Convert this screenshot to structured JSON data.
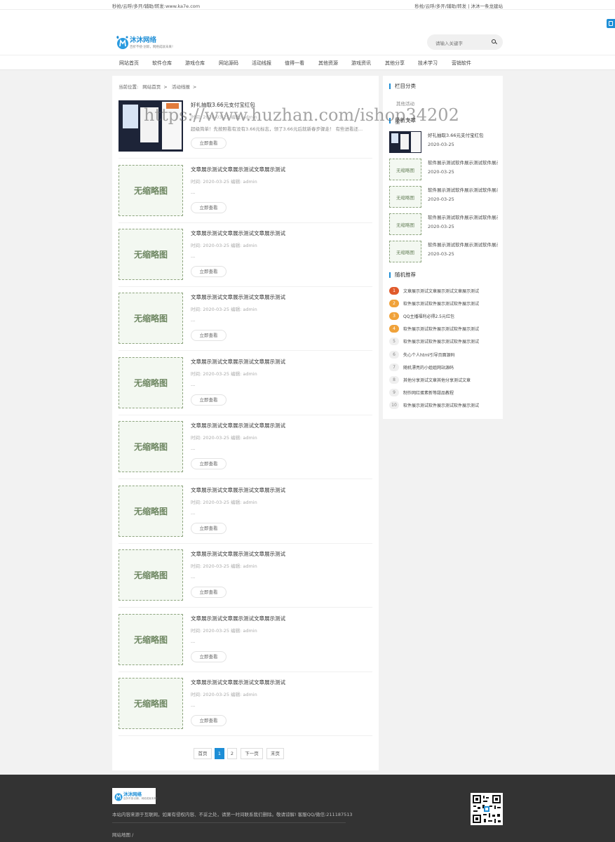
{
  "topbar": {
    "left": "秒抢/云呼/多开/辅助/转发:www.ka7e.com",
    "right": "秒抢/云呼/多开/辅助/转发 | 沐沐一条龙建站"
  },
  "logo": {
    "title": "沐沐网络",
    "slogan": "百折不挠·创新，网络成就未来！"
  },
  "search": {
    "placeholder": "请输入关键字"
  },
  "nav": [
    "网站首页",
    "软件仓库",
    "游戏仓库",
    "网站源码",
    "活动线报",
    "值得一看",
    "其他资源",
    "游戏资讯",
    "其他分享",
    "技术学习",
    "营销软件"
  ],
  "breadcrumb": {
    "label": "当前位置:",
    "home": "网站首页",
    "sep1": ">",
    "current": "活动线报",
    "sep2": ">"
  },
  "watermark": "https://www.huzhan.com/ishop34202",
  "posts": [
    {
      "title": "好礼抽取3.66元支付宝红包",
      "meta": "时间: 2020-03-25    编辑: admin",
      "desc": "超级简单！先按照看有没有3.66元标志，领了3.66元后就新春步骤走！ 有些进看还...",
      "btn": "立即查看",
      "thumb": ""
    },
    {
      "title": "文章展示测试文章展示测试文章展示测试",
      "meta": "时间: 2020-03-25    编辑: admin",
      "desc": "...",
      "btn": "立即查看",
      "thumb": "无缩略图"
    },
    {
      "title": "文章展示测试文章展示测试文章展示测试",
      "meta": "时间: 2020-03-25    编辑: admin",
      "desc": "...",
      "btn": "立即查看",
      "thumb": "无缩略图"
    },
    {
      "title": "文章展示测试文章展示测试文章展示测试",
      "meta": "时间: 2020-03-25    编辑: admin",
      "desc": "...",
      "btn": "立即查看",
      "thumb": "无缩略图"
    },
    {
      "title": "文章展示测试文章展示测试文章展示测试",
      "meta": "时间: 2020-03-25    编辑: admin",
      "desc": "...",
      "btn": "立即查看",
      "thumb": "无缩略图"
    },
    {
      "title": "文章展示测试文章展示测试文章展示测试",
      "meta": "时间: 2020-03-25    编辑: admin",
      "desc": "...",
      "btn": "立即查看",
      "thumb": "无缩略图"
    },
    {
      "title": "文章展示测试文章展示测试文章展示测试",
      "meta": "时间: 2020-03-25    编辑: admin",
      "desc": "...",
      "btn": "立即查看",
      "thumb": "无缩略图"
    },
    {
      "title": "文章展示测试文章展示测试文章展示测试",
      "meta": "时间: 2020-03-25    编辑: admin",
      "desc": "...",
      "btn": "立即查看",
      "thumb": "无缩略图"
    },
    {
      "title": "文章展示测试文章展示测试文章展示测试",
      "meta": "时间: 2020-03-25    编辑: admin",
      "desc": "...",
      "btn": "立即查看",
      "thumb": "无缩略图"
    },
    {
      "title": "文章展示测试文章展示测试文章展示测试",
      "meta": "时间: 2020-03-25    编辑: admin",
      "desc": "...",
      "btn": "立即查看",
      "thumb": "无缩略图"
    }
  ],
  "pagination": {
    "first": "首页",
    "p1": "1",
    "p2": "2",
    "next": "下一页",
    "last": "末页"
  },
  "sidebar": {
    "cat_title": "栏目分类",
    "cat_item": "其他活动",
    "latest_title": "最新文章",
    "latest": [
      {
        "title": "好礼抽取3.66元支付宝红包",
        "date": "2020-03-25",
        "thumb": ""
      },
      {
        "title": "软件展示测试软件展示测试软件展示测试",
        "date": "2020-03-25",
        "thumb": "无缩略图"
      },
      {
        "title": "软件展示测试软件展示测试软件展示测试",
        "date": "2020-03-25",
        "thumb": "无缩略图"
      },
      {
        "title": "软件展示测试软件展示测试软件展示测试",
        "date": "2020-03-25",
        "thumb": "无缩略图"
      },
      {
        "title": "软件展示测试软件展示测试软件展示测试",
        "date": "2020-03-25",
        "thumb": "无缩略图"
      }
    ],
    "rand_title": "随机推荐",
    "random": [
      {
        "n": "1",
        "t": "文章展示测试文章展示测试文章展示测试"
      },
      {
        "n": "2",
        "t": "软件展示测试软件展示测试软件展示测试"
      },
      {
        "n": "3",
        "t": "QQ主播福利必得2.5元红包"
      },
      {
        "n": "4",
        "t": "软件展示测试软件展示测试软件展示测试"
      },
      {
        "n": "5",
        "t": "软件展示测试软件展示测试软件展示测试"
      },
      {
        "n": "6",
        "t": "失心个人html引导页面源码"
      },
      {
        "n": "7",
        "t": "随机漂亮的小姐姐网站源码"
      },
      {
        "n": "8",
        "t": "其他分享测试文章其他分享测试文章"
      },
      {
        "n": "9",
        "t": "制作网红蛋素新等甜品教程"
      },
      {
        "n": "10",
        "t": "软件展示测试软件展示测试软件展示测试"
      }
    ]
  },
  "footer": {
    "logo_title": "沐沐网络",
    "logo_slogan": "百折不挠·创新，网络成就未来！",
    "text": "本站内容来源于互联网，如果有侵权内容、不妥之处，请第一时间联系我们删除。敬请谅解! 客服QQ/微信:211187513",
    "links": "网站地图    /"
  },
  "colors": {
    "accent": "#1e8ed6",
    "rank1": "#e05a2b",
    "rank2": "#f0a23a",
    "footer_bg": "#333333"
  }
}
